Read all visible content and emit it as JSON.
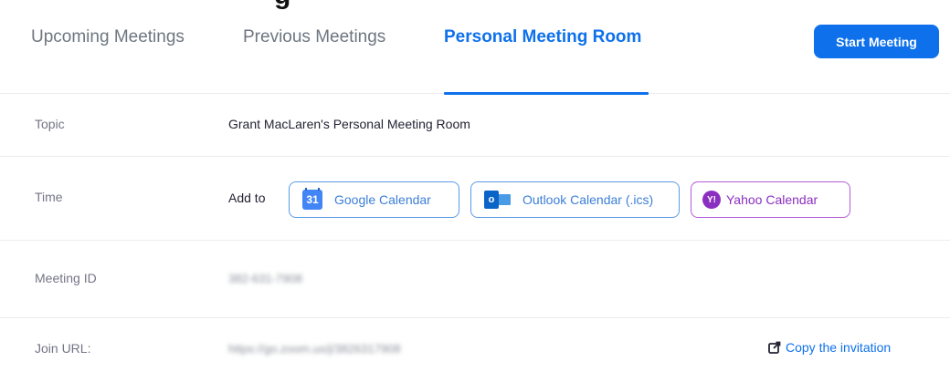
{
  "tabs": [
    {
      "label": "Upcoming Meetings",
      "active": false
    },
    {
      "label": "Previous Meetings",
      "active": false
    },
    {
      "label": "Personal Meeting Room",
      "active": true
    }
  ],
  "header": {
    "start_meeting_label": "Start Meeting"
  },
  "rows": {
    "topic": {
      "label": "Topic",
      "value": "Grant MacLaren's Personal Meeting Room"
    },
    "time": {
      "label": "Time",
      "add_to": "Add to",
      "calendars": [
        {
          "label": "Google Calendar",
          "icon": "google-calendar-icon",
          "icon_text": "31"
        },
        {
          "label": "Outlook Calendar (.ics)",
          "icon": "outlook-icon",
          "icon_text": "o"
        },
        {
          "label": "Yahoo Calendar",
          "icon": "yahoo-icon",
          "icon_text": "Y!"
        }
      ]
    },
    "meeting_id": {
      "label": "Meeting ID",
      "value": "382-631-7908"
    },
    "join_url": {
      "label": "Join URL:",
      "value": "https://go.zoom.us/j/3826317908",
      "copy_label": "Copy the invitation"
    }
  },
  "colors": {
    "accent": "#0e71eb",
    "label_gray": "#747487",
    "yahoo_purple": "#8b2fc0"
  }
}
